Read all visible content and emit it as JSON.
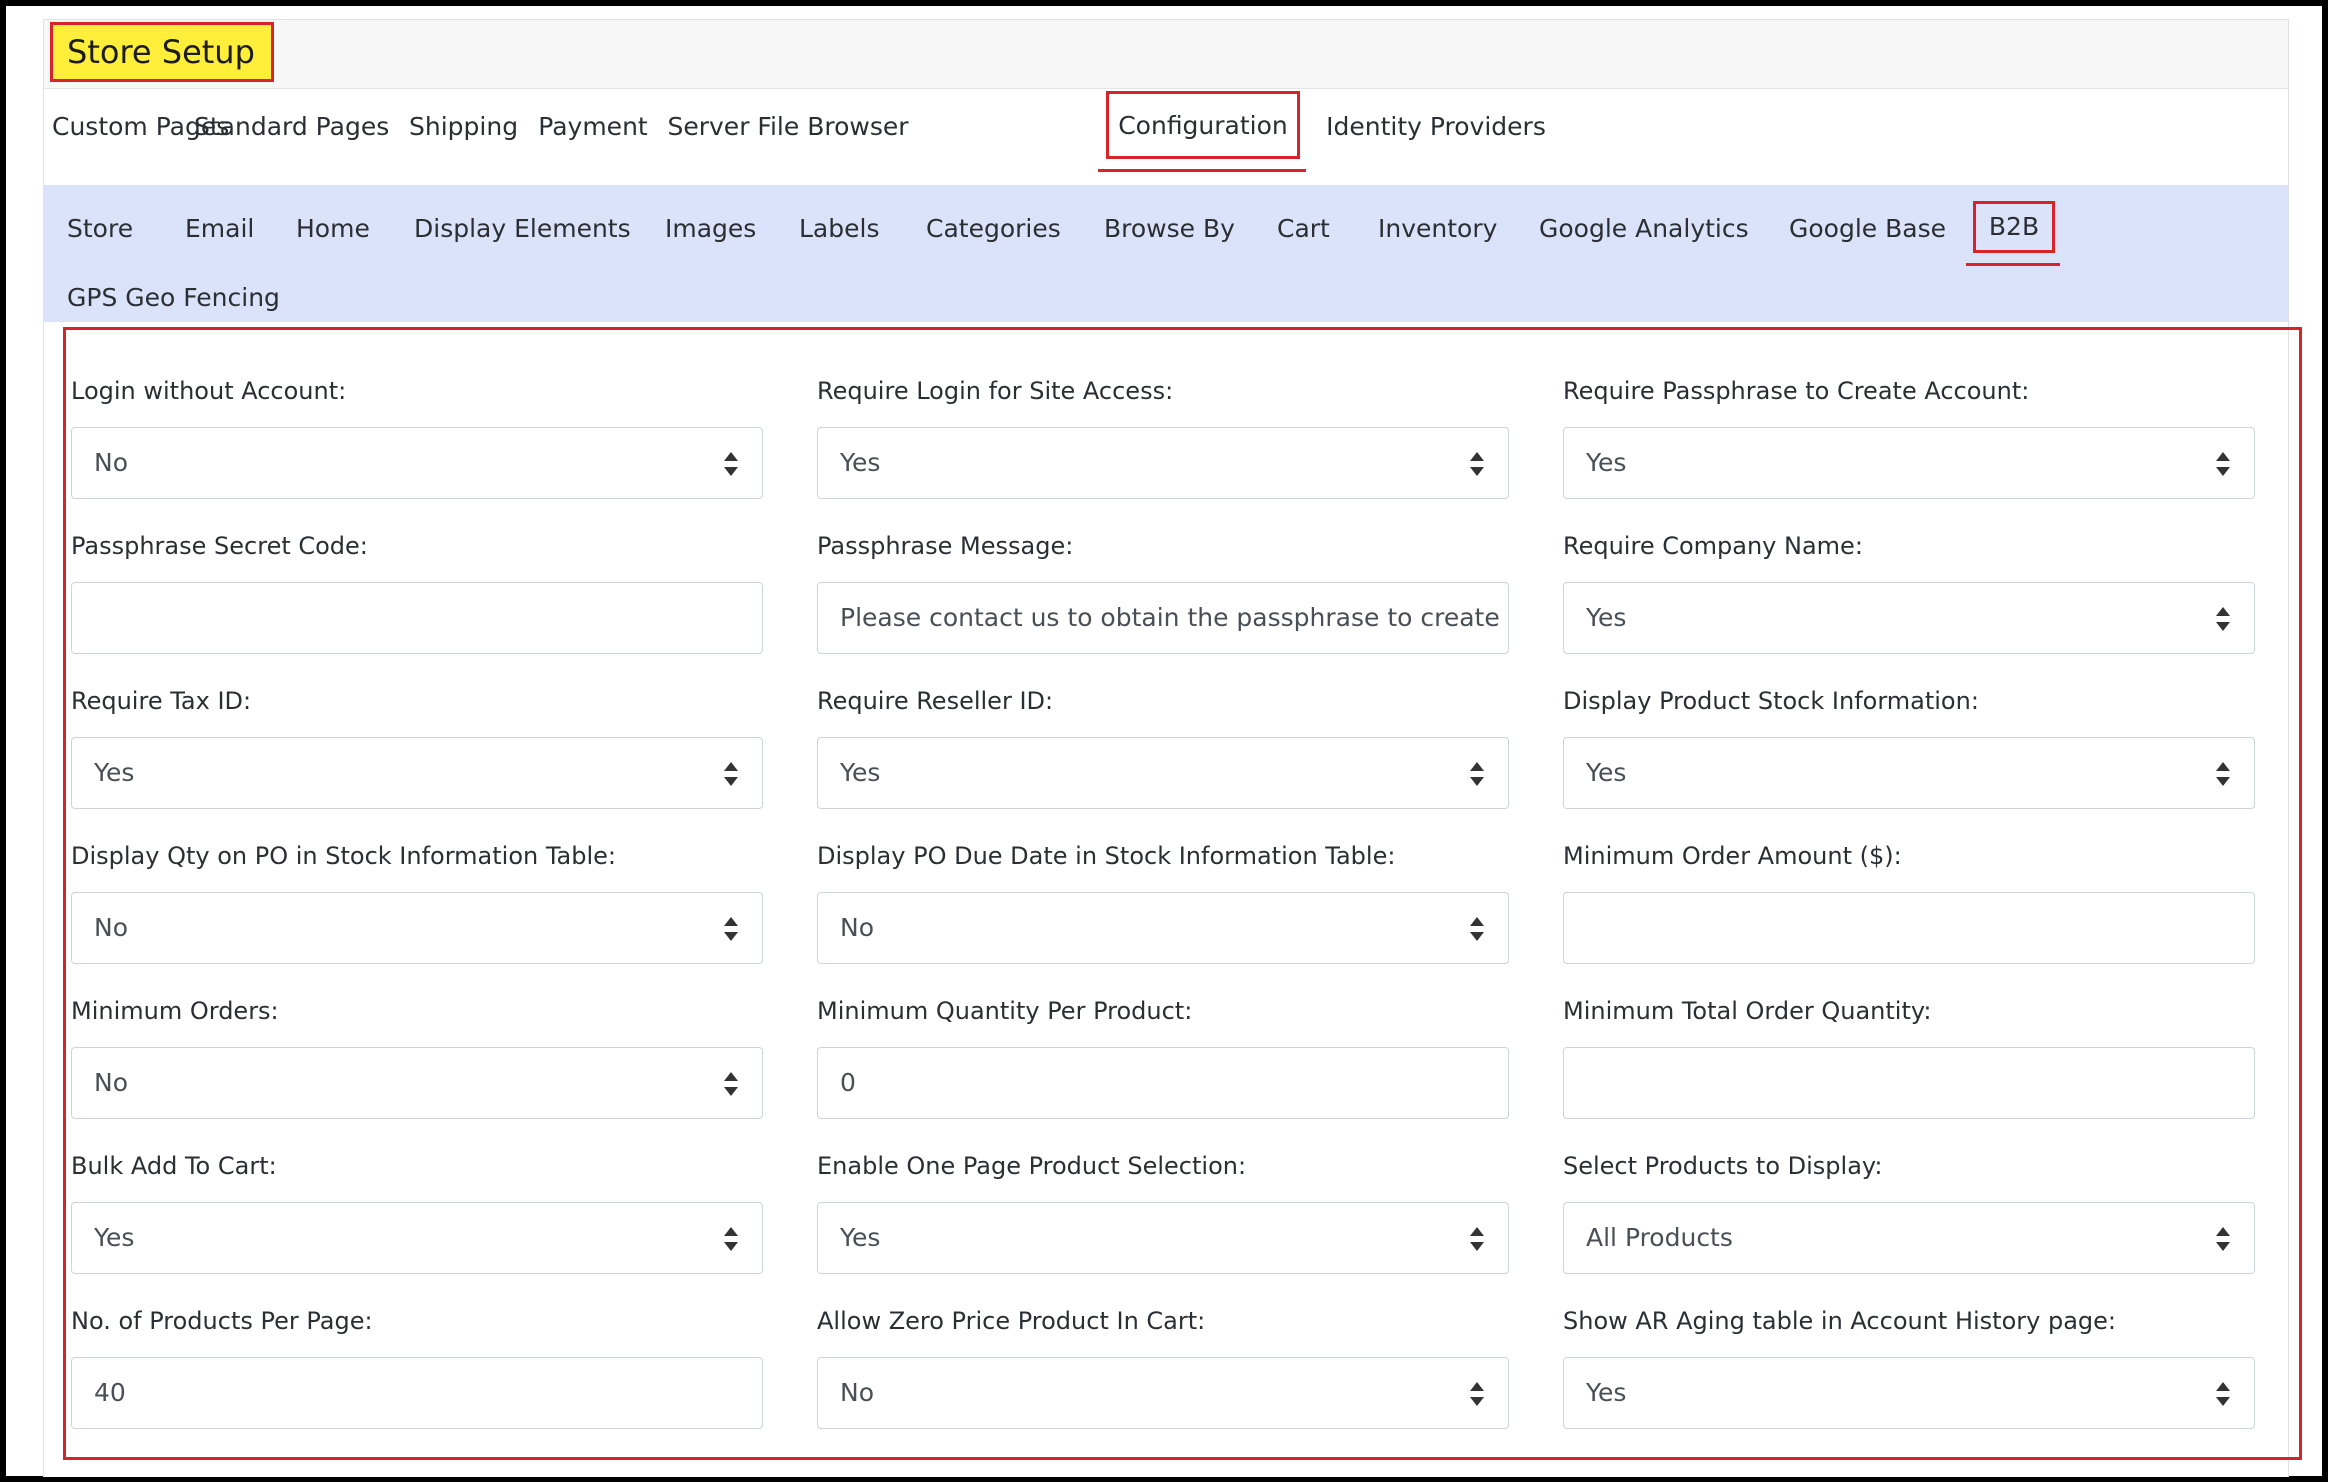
{
  "header": {
    "title": "Store Setup"
  },
  "tabs": [
    {
      "label": "Custom Pages",
      "active": false
    },
    {
      "label": "Standard Pages",
      "active": false
    },
    {
      "label": "Shipping",
      "active": false
    },
    {
      "label": "Payment",
      "active": false
    },
    {
      "label": "Server File Browser",
      "active": false
    },
    {
      "label": "Configuration",
      "active": true
    },
    {
      "label": "Identity Providers",
      "active": false
    }
  ],
  "subnav": [
    {
      "label": "Store",
      "active": false
    },
    {
      "label": "Email",
      "active": false
    },
    {
      "label": "Home",
      "active": false
    },
    {
      "label": "Display Elements",
      "active": false
    },
    {
      "label": "Images",
      "active": false
    },
    {
      "label": "Labels",
      "active": false
    },
    {
      "label": "Categories",
      "active": false
    },
    {
      "label": "Browse By",
      "active": false
    },
    {
      "label": "Cart",
      "active": false
    },
    {
      "label": "Inventory",
      "active": false
    },
    {
      "label": "Google Analytics",
      "active": false
    },
    {
      "label": "Google Base",
      "active": false
    },
    {
      "label": "B2B",
      "active": true
    },
    {
      "label": "GPS Geo Fencing",
      "active": false
    }
  ],
  "form": [
    {
      "label": "Login without Account:",
      "type": "select",
      "value": "No"
    },
    {
      "label": "Require Login for Site Access:",
      "type": "select",
      "value": "Yes"
    },
    {
      "label": "Require Passphrase to Create Account:",
      "type": "select",
      "value": "Yes"
    },
    {
      "label": "Passphrase Secret Code:",
      "type": "text",
      "value": ""
    },
    {
      "label": "Passphrase Message:",
      "type": "text",
      "value": "Please contact us to obtain the passphrase to create a"
    },
    {
      "label": "Require Company Name:",
      "type": "select",
      "value": "Yes"
    },
    {
      "label": "Require Tax ID:",
      "type": "select",
      "value": "Yes"
    },
    {
      "label": "Require Reseller ID:",
      "type": "select",
      "value": "Yes"
    },
    {
      "label": "Display Product Stock Information:",
      "type": "select",
      "value": "Yes"
    },
    {
      "label": "Display Qty on PO in Stock Information Table:",
      "type": "select",
      "value": "No"
    },
    {
      "label": "Display PO Due Date in Stock Information Table:",
      "type": "select",
      "value": "No"
    },
    {
      "label": "Minimum Order Amount ($):",
      "type": "text",
      "value": ""
    },
    {
      "label": "Minimum Orders:",
      "type": "select",
      "value": "No"
    },
    {
      "label": "Minimum Quantity Per Product:",
      "type": "text",
      "value": "0"
    },
    {
      "label": "Minimum Total Order Quantity:",
      "type": "text",
      "value": ""
    },
    {
      "label": "Bulk Add To Cart:",
      "type": "select",
      "value": "Yes"
    },
    {
      "label": "Enable One Page Product Selection:",
      "type": "select",
      "value": "Yes"
    },
    {
      "label": "Select Products to Display:",
      "type": "select",
      "value": "All Products"
    },
    {
      "label": "No. of Products Per Page:",
      "type": "text",
      "value": "40"
    },
    {
      "label": "Allow Zero Price Product In Cart:",
      "type": "select",
      "value": "No"
    },
    {
      "label": "Show AR Aging table in Account History page:",
      "type": "select",
      "value": "Yes"
    }
  ],
  "icons": {
    "select_caret": "sort-caret-icon"
  },
  "colors": {
    "highlight": "#d8232a",
    "title_bg": "#ffef3a",
    "subnav_bg": "#dbe3fb"
  }
}
